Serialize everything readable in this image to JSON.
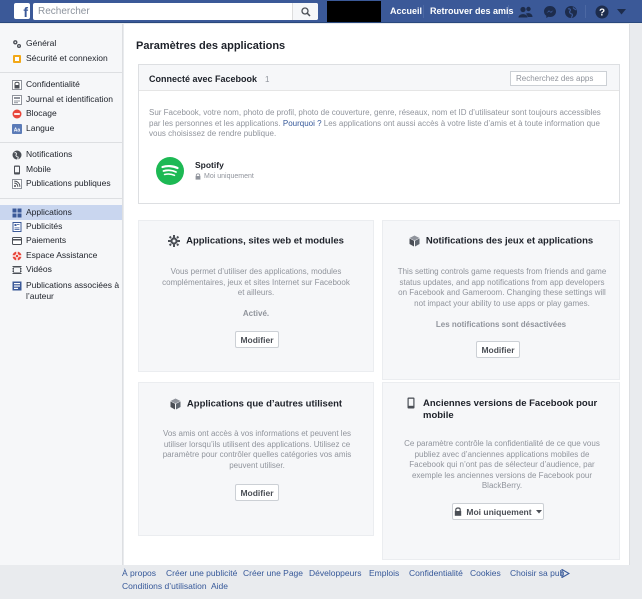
{
  "topbar": {
    "search_placeholder": "Rechercher",
    "nav": [
      "Accueil",
      "Retrouver des amis"
    ]
  },
  "sidebar": {
    "groups": [
      [
        {
          "label": "Général",
          "icon": "gear-icon"
        },
        {
          "label": "Sécurité et connexion",
          "icon": "shield-icon"
        }
      ],
      [
        {
          "label": "Confidentialité",
          "icon": "lock-icon"
        },
        {
          "label": "Journal et identification",
          "icon": "timeline-icon"
        },
        {
          "label": "Blocage",
          "icon": "block-icon"
        },
        {
          "label": "Langue",
          "icon": "language-icon"
        }
      ],
      [
        {
          "label": "Notifications",
          "icon": "globe-icon"
        },
        {
          "label": "Mobile",
          "icon": "phone-icon"
        },
        {
          "label": "Publications publiques",
          "icon": "rss-icon"
        }
      ],
      [
        {
          "label": "Applications",
          "icon": "apps-icon"
        },
        {
          "label": "Publicités",
          "icon": "ads-icon"
        },
        {
          "label": "Paiements",
          "icon": "card-icon"
        },
        {
          "label": "Espace Assistance",
          "icon": "support-icon"
        },
        {
          "label": "Vidéos",
          "icon": "video-icon"
        },
        {
          "label": "Publications associées à l’auteur",
          "icon": "author-icon"
        }
      ]
    ]
  },
  "main": {
    "title": "Paramètres des applications",
    "connected": {
      "title": "Connecté avec Facebook",
      "count": "1",
      "search_placeholder": "Recherchez des apps",
      "desc_before": "Sur Facebook, votre nom, photo de profil, photo de couverture, genre, réseaux, nom et ID d’utilisateur sont toujours accessibles par les personnes et les applications. ",
      "desc_link": "Pourquoi ?",
      "desc_after": " Les applications ont aussi accès à votre liste d’amis et à toute information que vous choisissez de rendre publique.",
      "app_name": "Spotify",
      "app_privacy": "Moi uniquement"
    },
    "cards": {
      "apps_sites": {
        "title": "Applications, sites web et modules",
        "desc": "Vous permet d’utiliser des applications, modules complémentaires, jeux et sites Internet sur Facebook et ailleurs.",
        "status": "Activé.",
        "button": "Modifier"
      },
      "game_notifs": {
        "title": "Notifications des jeux et applications",
        "desc": "This setting controls game requests from friends and game status updates, and app notifications from app developers on Facebook and Gameroom. Changing these settings will not impact your ability to use apps or play games.",
        "status": "Les notifications sont désactivées",
        "button": "Modifier"
      },
      "others_use": {
        "title": "Applications que d’autres utilisent",
        "desc": "Vos amis ont accès à vos informations et peuvent les utiliser lorsqu’ils utilisent des applications. Utilisez ce paramètre pour contrôler quelles catégories vos amis peuvent utiliser.",
        "button": "Modifier"
      },
      "old_versions": {
        "title": "Anciennes versions de Facebook pour mobile",
        "desc": "Ce paramètre contrôle la confidentialité de ce que vous publiez avec d’anciennes applications mobiles de Facebook qui n’ont pas de sélecteur d’audience, par exemple les anciennes versions de Facebook pour BlackBerry.",
        "button": "Moi uniquement"
      }
    }
  },
  "footer": {
    "row1": [
      "À propos",
      "Créer une publicité",
      "Créer une Page",
      "Développeurs",
      "Emplois",
      "Confidentialité",
      "Cookies",
      "Choisir sa pub"
    ],
    "row2": [
      "Conditions d’utilisation",
      "Aide"
    ]
  }
}
